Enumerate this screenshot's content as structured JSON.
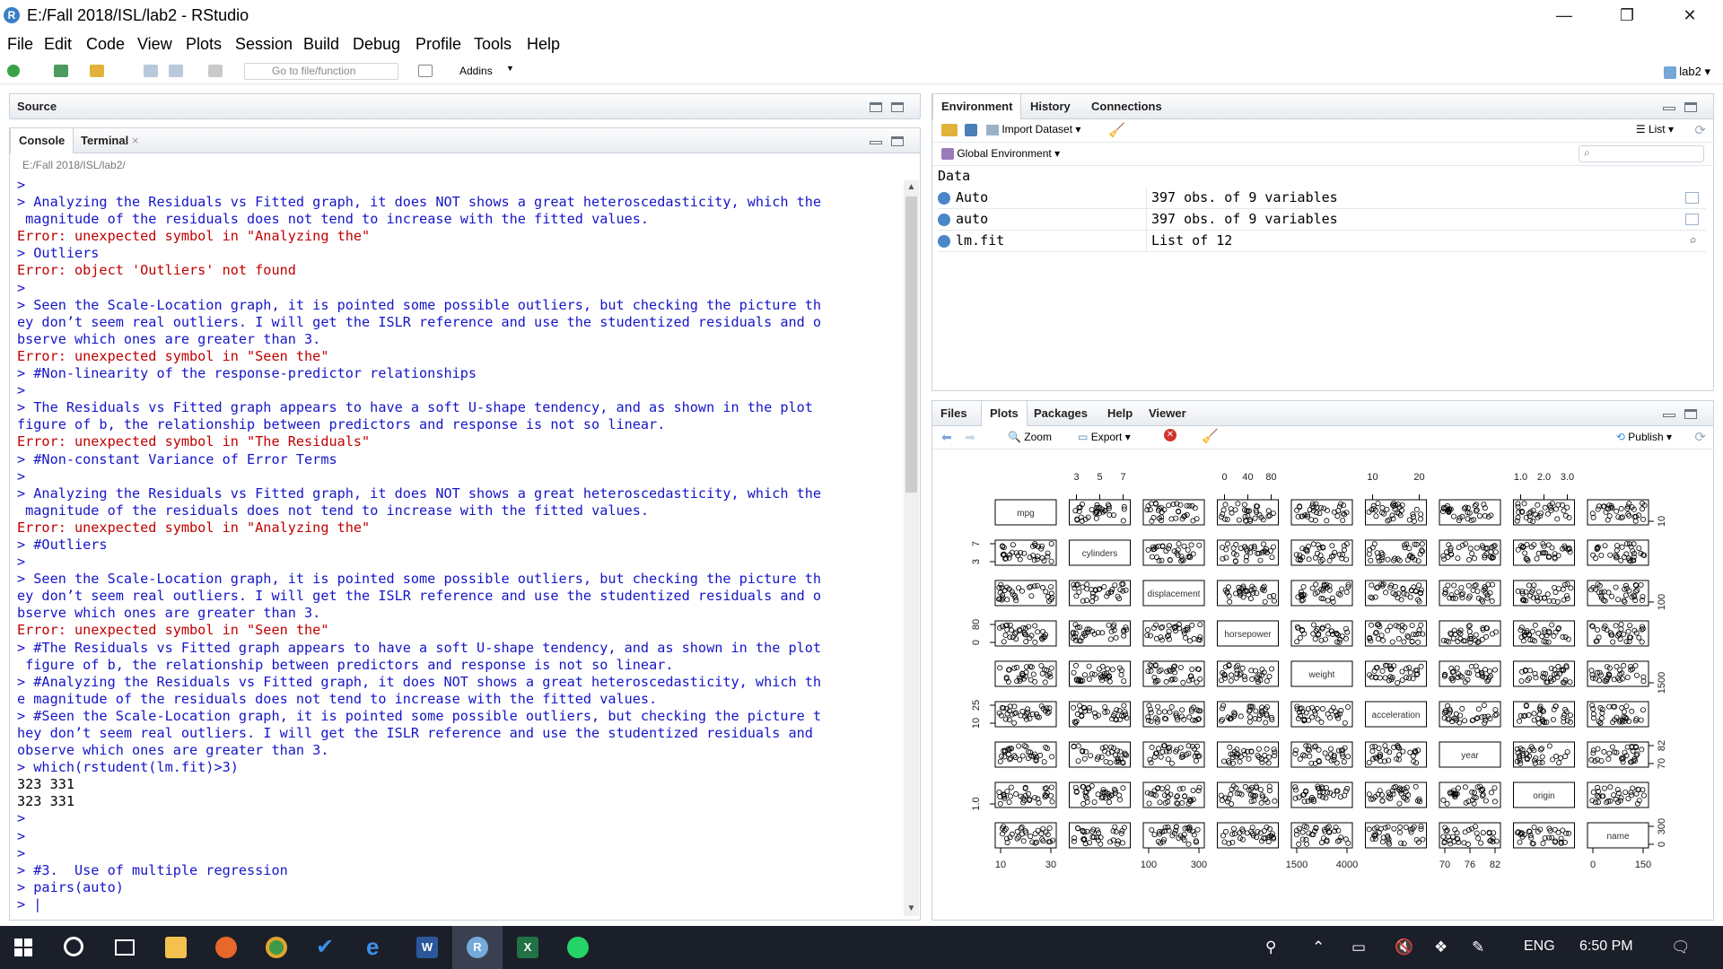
{
  "window": {
    "title": "E:/Fall 2018/ISL/lab2 - RStudio",
    "logo": "R",
    "buttons": {
      "minimize": "—",
      "restore": "❐",
      "close": "✕"
    }
  },
  "menu": [
    "File",
    "Edit",
    "Code",
    "View",
    "Plots",
    "Session",
    "Build",
    "Debug",
    "Profile",
    "Tools",
    "Help"
  ],
  "toolbar": {
    "goto_placeholder": "Go to file/function",
    "addins": "Addins",
    "project": "lab2"
  },
  "source": {
    "tab": "Source"
  },
  "console": {
    "tabs": [
      "Console",
      "Terminal"
    ],
    "path": "E:/Fall 2018/ISL/lab2/",
    "lines": [
      {
        "t": "cmd",
        "s": ">"
      },
      {
        "t": "cmd",
        "s": "> Analyzing the Residuals vs Fitted graph, it does NOT shows a great heteroscedasticity, which the"
      },
      {
        "t": "cmd",
        "s": " magnitude of the residuals does not tend to increase with the fitted values."
      },
      {
        "t": "err",
        "s": "Error: unexpected symbol in \"Analyzing the\""
      },
      {
        "t": "cmd",
        "s": "> Outliers"
      },
      {
        "t": "err",
        "s": "Error: object 'Outliers' not found"
      },
      {
        "t": "cmd",
        "s": ">"
      },
      {
        "t": "cmd",
        "s": "> Seen the Scale-Location graph, it is pointed some possible outliers, but checking the picture th"
      },
      {
        "t": "cmd",
        "s": "ey don’t seem real outliers. I will get the ISLR reference and use the studentized residuals and o"
      },
      {
        "t": "cmd",
        "s": "bserve which ones are greater than 3."
      },
      {
        "t": "err",
        "s": "Error: unexpected symbol in \"Seen the\""
      },
      {
        "t": "cmd",
        "s": "> #Non-linearity of the response-predictor relationships"
      },
      {
        "t": "cmd",
        "s": ">"
      },
      {
        "t": "cmd",
        "s": "> The Residuals vs Fitted graph appears to have a soft U-shape tendency, and as shown in the plot"
      },
      {
        "t": "cmd",
        "s": "figure of b, the relationship between predictors and response is not so linear."
      },
      {
        "t": "err",
        "s": "Error: unexpected symbol in \"The Residuals\""
      },
      {
        "t": "cmd",
        "s": "> #Non-constant Variance of Error Terms"
      },
      {
        "t": "cmd",
        "s": ">"
      },
      {
        "t": "cmd",
        "s": "> Analyzing the Residuals vs Fitted graph, it does NOT shows a great heteroscedasticity, which the"
      },
      {
        "t": "cmd",
        "s": " magnitude of the residuals does not tend to increase with the fitted values."
      },
      {
        "t": "err",
        "s": "Error: unexpected symbol in \"Analyzing the\""
      },
      {
        "t": "cmd",
        "s": "> #Outliers"
      },
      {
        "t": "cmd",
        "s": ">"
      },
      {
        "t": "cmd",
        "s": "> Seen the Scale-Location graph, it is pointed some possible outliers, but checking the picture th"
      },
      {
        "t": "cmd",
        "s": "ey don’t seem real outliers. I will get the ISLR reference and use the studentized residuals and o"
      },
      {
        "t": "cmd",
        "s": "bserve which ones are greater than 3."
      },
      {
        "t": "err",
        "s": "Error: unexpected symbol in \"Seen the\""
      },
      {
        "t": "cmd",
        "s": "> #The Residuals vs Fitted graph appears to have a soft U-shape tendency, and as shown in the plot"
      },
      {
        "t": "cmd",
        "s": " figure of b, the relationship between predictors and response is not so linear."
      },
      {
        "t": "cmd",
        "s": "> #Analyzing the Residuals vs Fitted graph, it does NOT shows a great heteroscedasticity, which th"
      },
      {
        "t": "cmd",
        "s": "e magnitude of the residuals does not tend to increase with the fitted values."
      },
      {
        "t": "cmd",
        "s": "> #Seen the Scale-Location graph, it is pointed some possible outliers, but checking the picture t"
      },
      {
        "t": "cmd",
        "s": "hey don’t seem real outliers. I will get the ISLR reference and use the studentized residuals and"
      },
      {
        "t": "cmd",
        "s": "observe which ones are greater than 3."
      },
      {
        "t": "cmd",
        "s": "> which(rstudent(lm.fit)>3)"
      },
      {
        "t": "out",
        "s": "323 331"
      },
      {
        "t": "out",
        "s": "323 331"
      },
      {
        "t": "cmd",
        "s": ">"
      },
      {
        "t": "cmd",
        "s": ">"
      },
      {
        "t": "cmd",
        "s": ">"
      },
      {
        "t": "cmd",
        "s": "> #3.  Use of multiple regression"
      },
      {
        "t": "cmd",
        "s": "> pairs(auto)"
      },
      {
        "t": "cmd",
        "s": "> |"
      }
    ]
  },
  "environment": {
    "tabs": [
      "Environment",
      "History",
      "Connections"
    ],
    "import_dataset": "Import Dataset",
    "view_mode": "List",
    "scope": "Global Environment",
    "section": "Data",
    "rows": [
      {
        "name": "Auto",
        "value": "397 obs. of 9 variables"
      },
      {
        "name": "auto",
        "value": "397 obs. of 9 variables"
      },
      {
        "name": "lm.fit",
        "value": "List of 12"
      }
    ]
  },
  "plots": {
    "tabs": [
      "Files",
      "Plots",
      "Packages",
      "Help",
      "Viewer"
    ],
    "zoom": "Zoom",
    "export": "Export",
    "publish": "Publish"
  },
  "chart_data": {
    "type": "scatter",
    "kind": "pairs scatterplot matrix",
    "variables": [
      "mpg",
      "cylinders",
      "displacement",
      "horsepower",
      "weight",
      "acceleration",
      "year",
      "origin",
      "name"
    ],
    "top_ticks": {
      "cylinders": [
        "3",
        "5",
        "7"
      ],
      "horsepower": [
        "0",
        "40",
        "80"
      ],
      "acceleration": [
        "10",
        "20"
      ],
      "origin": [
        "1.0",
        "2.0",
        "3.0"
      ]
    },
    "bottom_ticks": {
      "mpg": [
        "10",
        "30"
      ],
      "displacement": [
        "100",
        "300"
      ],
      "weight": [
        "1500",
        "4000"
      ],
      "year": [
        "70",
        "76",
        "82"
      ],
      "name": [
        "0",
        "150"
      ]
    },
    "left_ticks": {
      "cylinders": [
        "3",
        "7"
      ],
      "horsepower": [
        "0",
        "80"
      ],
      "acceleration": [
        "10",
        "25"
      ],
      "origin": [
        "1.0"
      ]
    },
    "right_ticks": {
      "mpg": [
        "10"
      ],
      "displacement": [
        "100"
      ],
      "weight": [
        "1500"
      ],
      "year": [
        "70",
        "82"
      ],
      "name": [
        "0",
        "300"
      ]
    }
  },
  "taskbar": {
    "lang": "ENG",
    "time": "6:50 PM"
  }
}
